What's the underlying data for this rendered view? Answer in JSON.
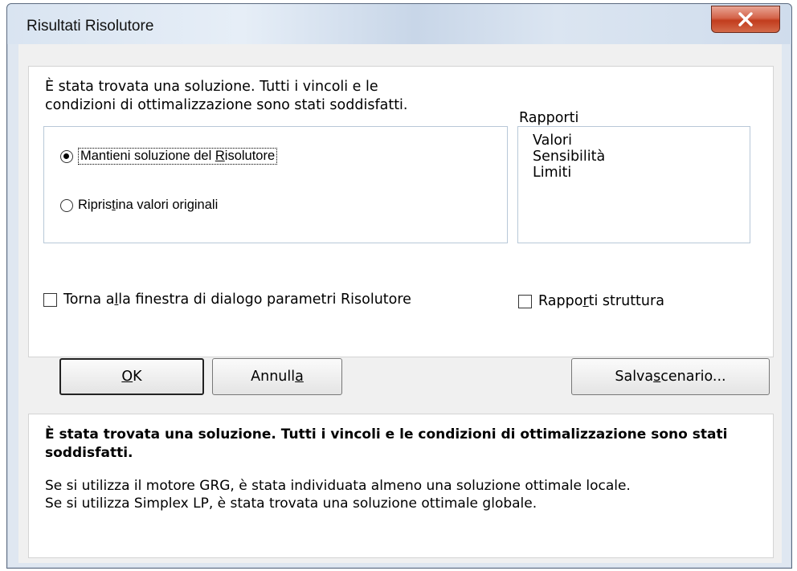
{
  "window": {
    "title": "Risultati Risolutore",
    "close_label": "X"
  },
  "message": {
    "line1": "È stata trovata una soluzione. Tutti i vincoli e le",
    "line2": "condizioni di ottimalizzazione sono stati soddisfatti."
  },
  "options": {
    "keep": {
      "before": "Mantieni soluzione del ",
      "accel": "R",
      "after": "isolutore",
      "selected": true
    },
    "restore": {
      "before": "Ripris",
      "accel": "t",
      "after": "ina valori originali",
      "selected": false
    }
  },
  "reports": {
    "label": "Rapporti",
    "items": [
      "Valori",
      "Sensibilità",
      "Limiti"
    ]
  },
  "checks": {
    "return_dialog": {
      "before": "Torna a",
      "accel": "l",
      "after": "la finestra di dialogo parametri Risolutore",
      "checked": false
    },
    "outline_reports": {
      "before": "Rappo",
      "accel": "r",
      "after": "ti struttura",
      "checked": false
    }
  },
  "buttons": {
    "ok": {
      "before": "",
      "accel": "O",
      "after": "K"
    },
    "cancel": {
      "before": "Annull",
      "accel": "a",
      "after": ""
    },
    "save": {
      "before": "Salva ",
      "accel": "s",
      "after": "cenario..."
    }
  },
  "info": {
    "bold": "È stata trovata una soluzione. Tutti i vincoli e le condizioni di ottimalizzazione sono stati soddisfatti.",
    "line1": "Se si utilizza il motore GRG, è stata individuata almeno una soluzione ottimale locale.",
    "line2": "Se si utilizza Simplex LP, è stata trovata una soluzione ottimale globale."
  }
}
